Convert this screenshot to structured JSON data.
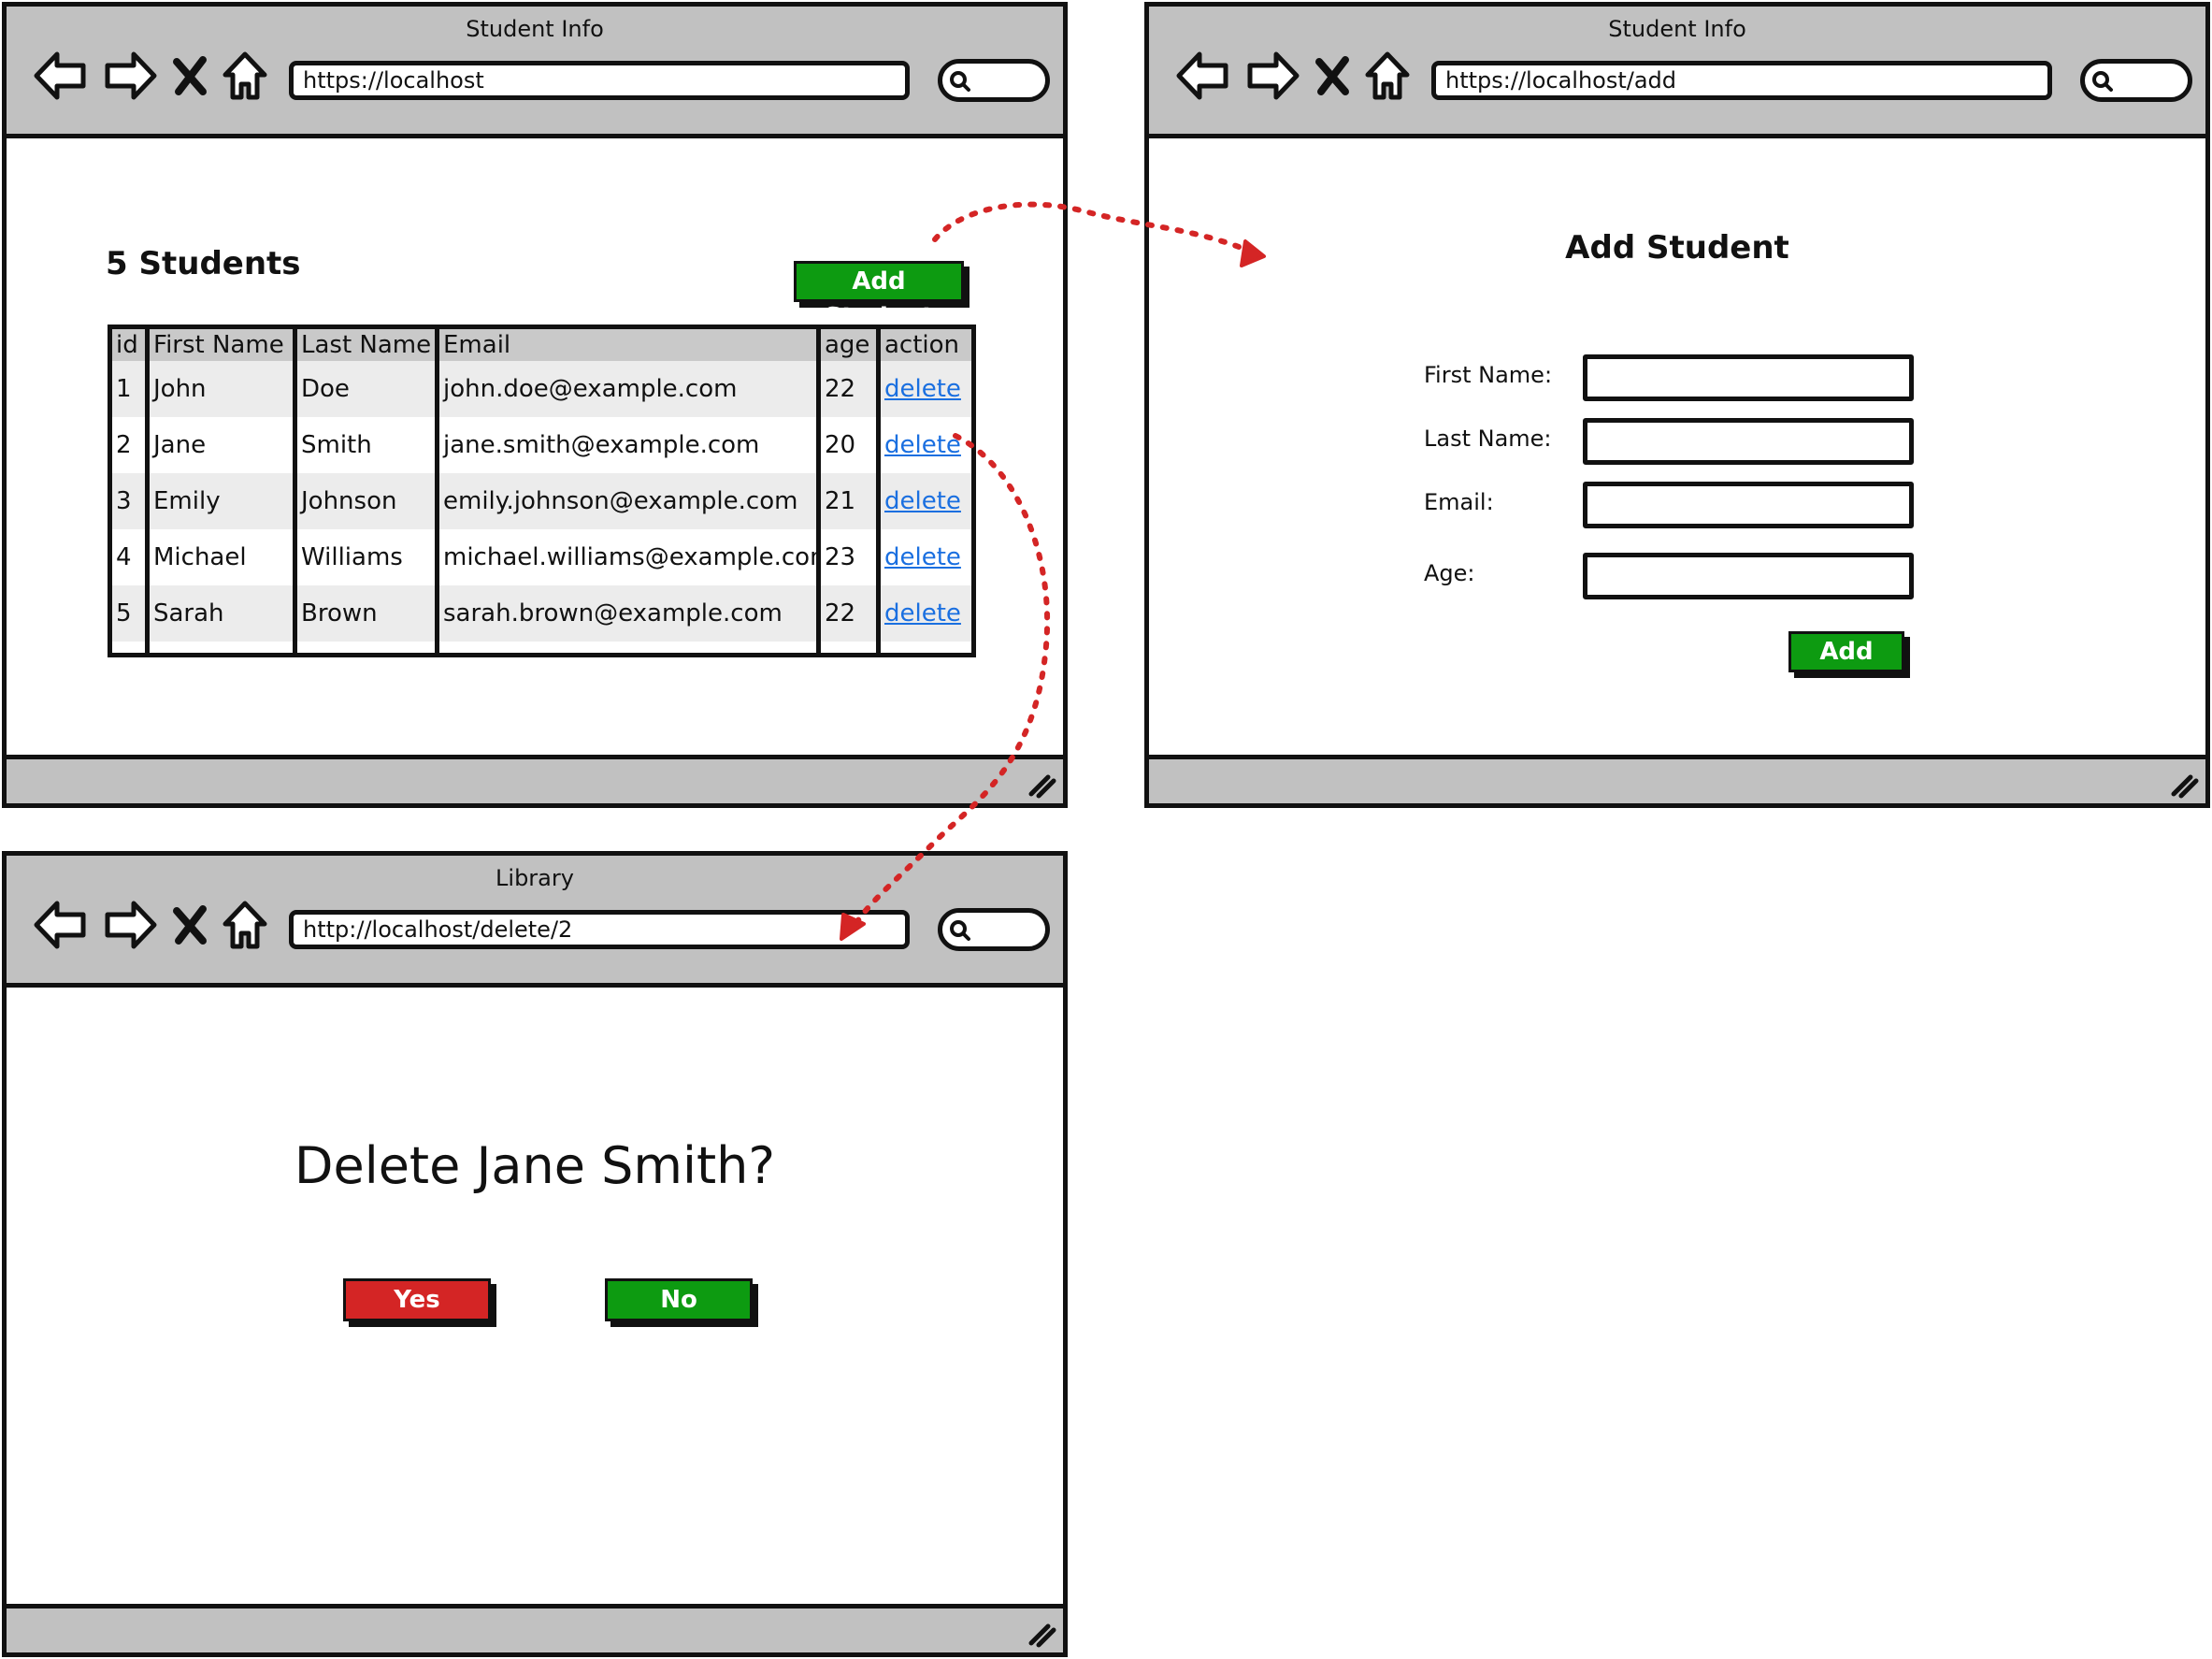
{
  "icons": {
    "back": "arrow-left-icon",
    "forward": "arrow-right-icon",
    "stop": "close-icon",
    "home": "home-icon",
    "search": "search-icon",
    "resize": "resize-grip-icon"
  },
  "colors": {
    "chrome": "#c1c1c1",
    "accent_green": "#0d9b11",
    "accent_red": "#d42525",
    "link": "#1a6fe0",
    "arrow": "#d42525",
    "table_header": "#c9c9c9",
    "row_alt": "#ececec"
  },
  "list_window": {
    "title": "Student Info",
    "url": "https://localhost",
    "heading": "5 Students",
    "add_button": "Add Student",
    "table": {
      "headers": [
        "id",
        "First Name",
        "Last Name",
        "Email",
        "age",
        "action"
      ],
      "rows": [
        [
          "1",
          "John",
          "Doe",
          "john.doe@example.com",
          "22",
          "delete"
        ],
        [
          "2",
          "Jane",
          "Smith",
          "jane.smith@example.com",
          "20",
          "delete"
        ],
        [
          "3",
          "Emily",
          "Johnson",
          "emily.johnson@example.com",
          "21",
          "delete"
        ],
        [
          "4",
          "Michael",
          "Williams",
          "michael.williams@example.com",
          "23",
          "delete"
        ],
        [
          "5",
          "Sarah",
          "Brown",
          "sarah.brown@example.com",
          "22",
          "delete"
        ]
      ]
    }
  },
  "add_window": {
    "title": "Student Info",
    "url": "https://localhost/add",
    "heading": "Add Student",
    "fields": [
      {
        "label": "First Name:",
        "value": ""
      },
      {
        "label": "Last Name:",
        "value": ""
      },
      {
        "label": "Email:",
        "value": ""
      },
      {
        "label": "Age:",
        "value": ""
      }
    ],
    "submit": "Add"
  },
  "delete_window": {
    "title": "Library",
    "url": "http://localhost/delete/2",
    "question": "Delete Jane Smith?",
    "yes": "Yes",
    "no": "No"
  }
}
